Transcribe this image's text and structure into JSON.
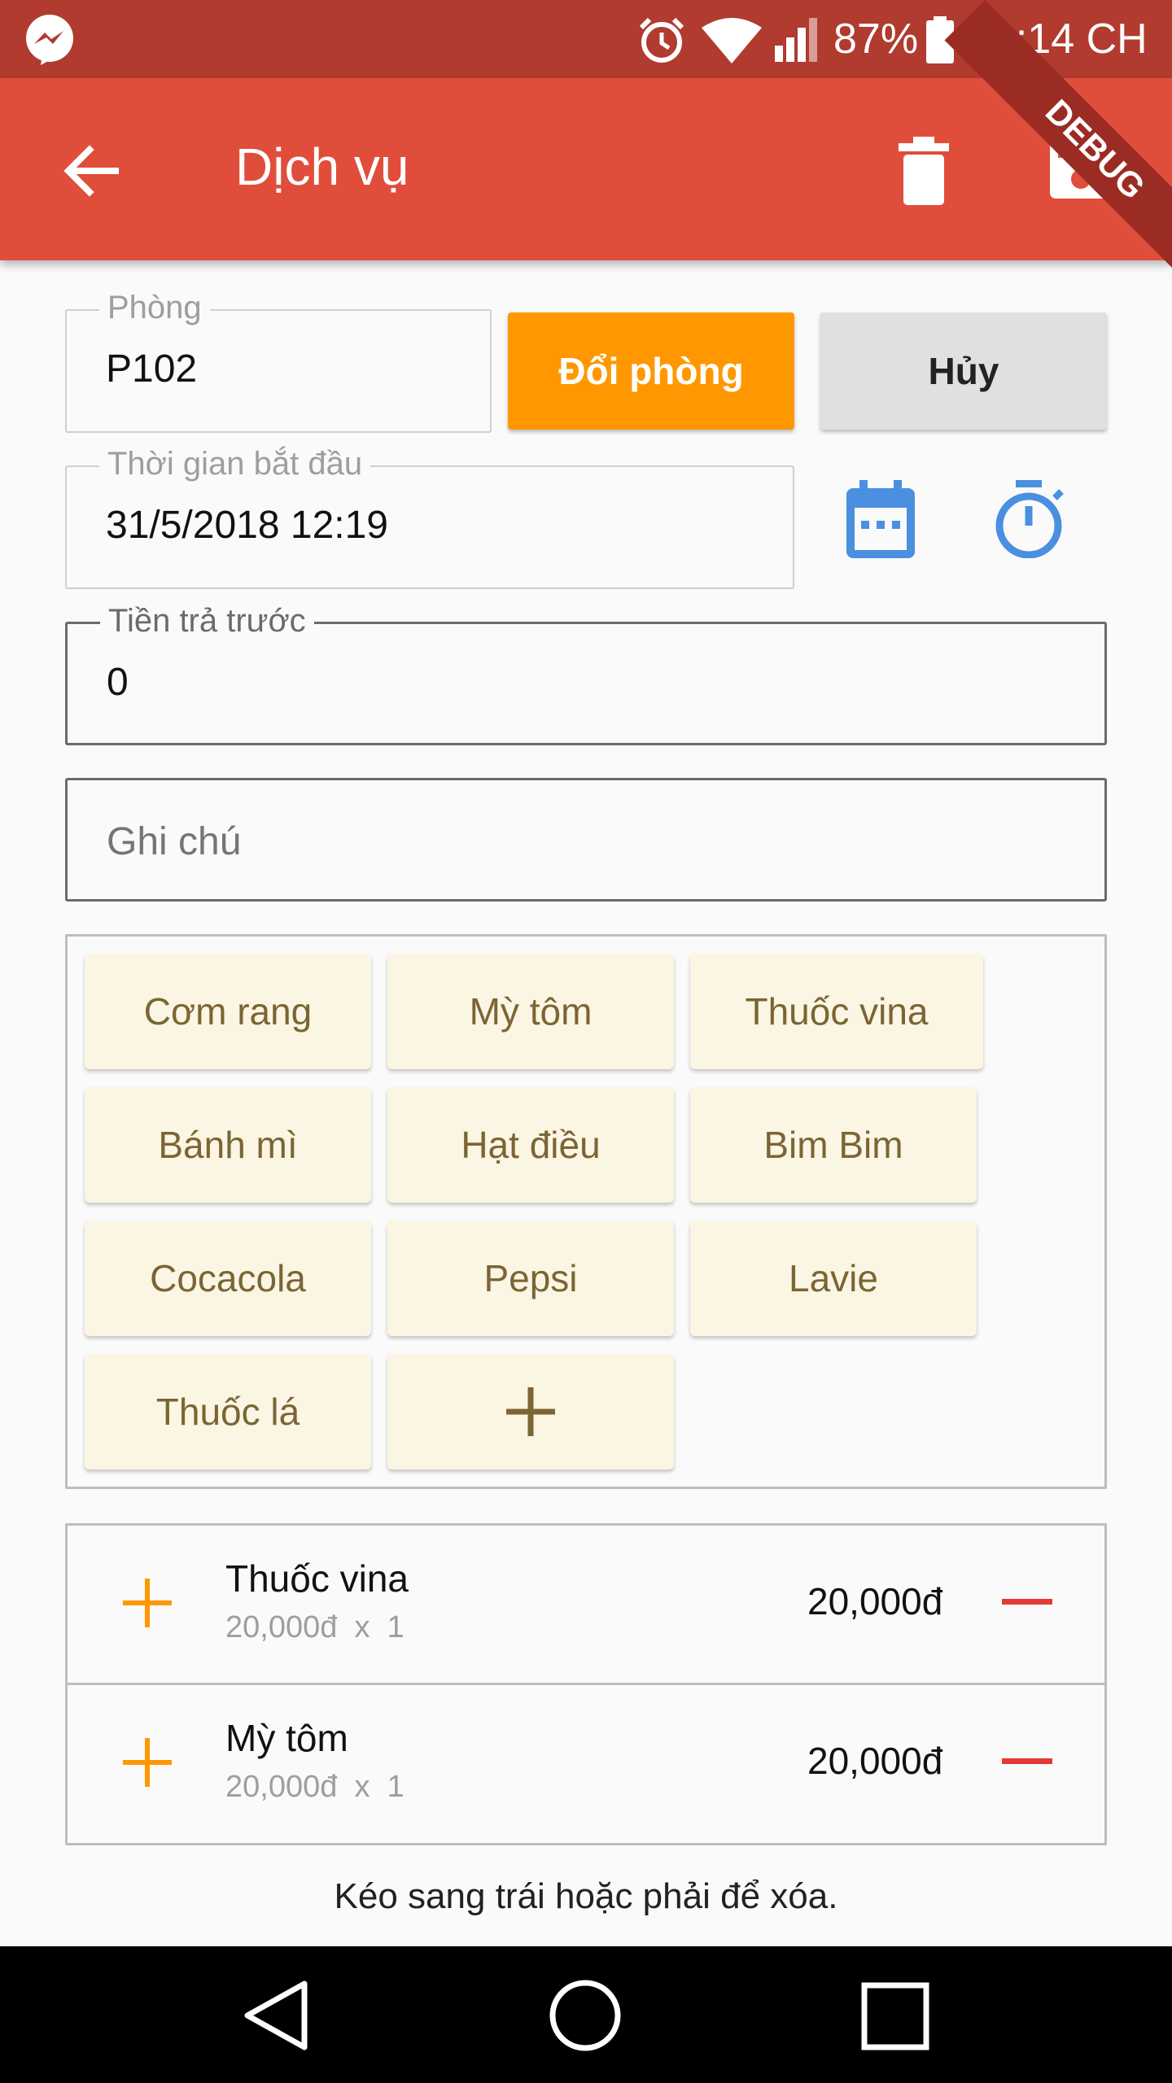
{
  "status_bar": {
    "battery": "87%",
    "time": "10:14 CH",
    "debug_banner": "DEBUG",
    "icons": [
      "messenger-icon",
      "alarm-icon",
      "wifi-icon",
      "signal-icon",
      "battery-icon"
    ]
  },
  "app_bar": {
    "title": "Dịch vụ",
    "icons": [
      "back-arrow-icon",
      "delete-icon",
      "save-icon"
    ]
  },
  "form": {
    "room": {
      "label": "Phòng",
      "value": "P102"
    },
    "change_room_button": "Đổi phòng",
    "cancel_button": "Hủy",
    "start_time": {
      "label": "Thời gian bắt đầu",
      "value": "31/5/2018 12:19"
    },
    "prepaid": {
      "label": "Tiền trả trước",
      "value": "0"
    },
    "note": {
      "placeholder": "Ghi chú"
    }
  },
  "services": {
    "items": [
      "Cơm rang",
      "Mỳ tôm",
      "Thuốc vina",
      "Bánh mì",
      "Hạt điều",
      "Bim Bim",
      "Cocacola",
      "Pepsi",
      "Lavie",
      "Thuốc lá"
    ],
    "add_icon": "plus-icon"
  },
  "order": {
    "rows": [
      {
        "name": "Thuốc vina",
        "price": "20,000đ",
        "times": "x",
        "qty": "1",
        "total": "20,000đ"
      },
      {
        "name": "Mỳ tôm",
        "price": "20,000đ",
        "times": "x",
        "qty": "1",
        "total": "20,000đ"
      }
    ],
    "hint": "Kéo sang trái hoặc phải để xóa."
  },
  "colors": {
    "status_bar": "#b03b2e",
    "app_bar": "#e04e3b",
    "orange": "#ff9800",
    "blue_icon": "#4a8fe0",
    "chip_bg": "#fbf6e3",
    "chip_text": "#7b6534",
    "minus": "#e53935"
  }
}
